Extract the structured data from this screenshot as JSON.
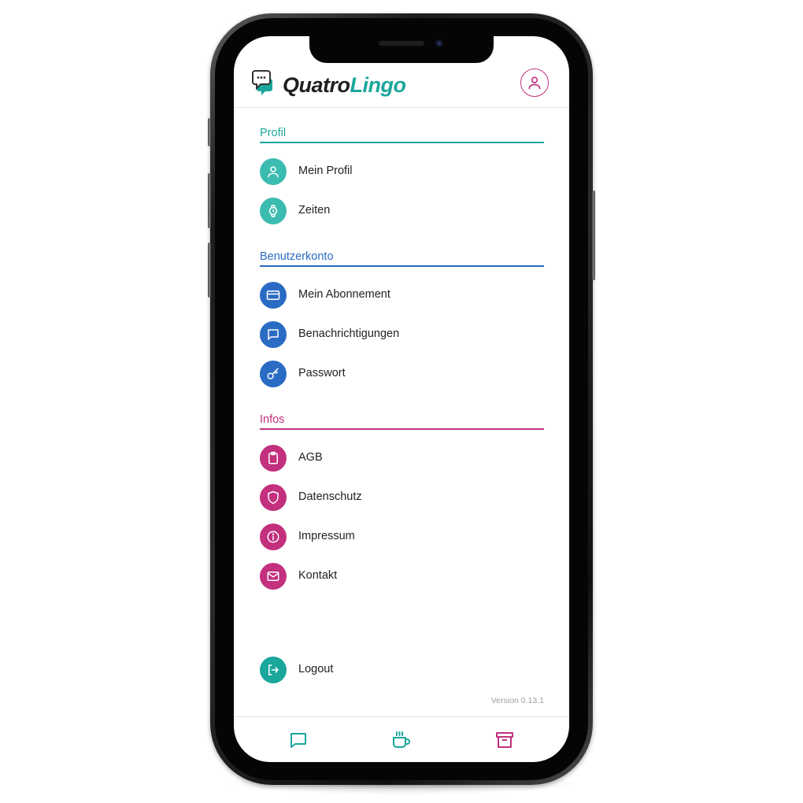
{
  "brand": {
    "name_part1": "Quatro",
    "name_part2": "Lingo",
    "colors": {
      "teal": "#1aa69b",
      "blue": "#2a6bc4",
      "magenta": "#c2307e"
    }
  },
  "header": {
    "profile_button_icon": "user-icon"
  },
  "sections": {
    "profil": {
      "title": "Profil",
      "items": [
        {
          "label": "Mein Profil",
          "icon": "user-icon"
        },
        {
          "label": "Zeiten",
          "icon": "watch-icon"
        }
      ]
    },
    "konto": {
      "title": "Benutzerkonto",
      "items": [
        {
          "label": "Mein Abonnement",
          "icon": "credit-card-icon"
        },
        {
          "label": "Benachrichtigungen",
          "icon": "message-icon"
        },
        {
          "label": "Passwort",
          "icon": "key-icon"
        }
      ]
    },
    "infos": {
      "title": "Infos",
      "items": [
        {
          "label": "AGB",
          "icon": "clipboard-icon"
        },
        {
          "label": "Datenschutz",
          "icon": "shield-icon"
        },
        {
          "label": "Impressum",
          "icon": "info-icon"
        },
        {
          "label": "Kontakt",
          "icon": "mail-icon"
        }
      ]
    }
  },
  "logout": {
    "label": "Logout",
    "icon": "logout-icon"
  },
  "version": "Version 0.13.1",
  "tabbar": [
    {
      "icon": "chat-icon"
    },
    {
      "icon": "coffee-icon"
    },
    {
      "icon": "archive-icon"
    }
  ]
}
